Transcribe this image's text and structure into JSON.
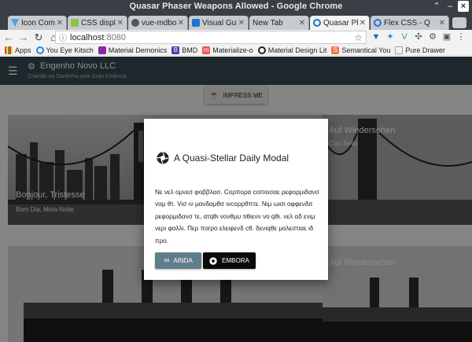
{
  "window": {
    "title": "Quasar Phaser Weapons Allowed - Google Chrome",
    "controls": [
      "⌃",
      "–",
      "×"
    ]
  },
  "tabs": [
    {
      "label": "Icon Compo",
      "favicon_color": "#42a5f5",
      "active": false
    },
    {
      "label": "CSS display",
      "favicon_color": "#8bc34a",
      "active": false
    },
    {
      "label": "vue-mdbootst",
      "favicon_color": "#555555",
      "active": false
    },
    {
      "label": "Visual Guid",
      "favicon_color": "#1976d2",
      "active": false
    },
    {
      "label": "New Tab",
      "favicon_color": "",
      "active": false
    },
    {
      "label": "Quasar Pha",
      "favicon_color": "#1976d2",
      "active": true
    },
    {
      "label": "Flex CSS - Q",
      "favicon_color": "#1976d2",
      "active": false
    }
  ],
  "omnibox": {
    "host": "localhost",
    "port": ":8080"
  },
  "bookmarks": [
    {
      "label": "Apps",
      "icon_color": "#e53935"
    },
    {
      "label": "You Eye Kitsch",
      "icon_color": "#1e88e5"
    },
    {
      "label": "Material Demonics",
      "icon_color": "#8e24aa"
    },
    {
      "label": "BMD",
      "icon_color": "#5e35b1"
    },
    {
      "label": "Materialize-o",
      "icon_color": "#ef5350"
    },
    {
      "label": "Material Design Lit",
      "icon_color": "#212121"
    },
    {
      "label": "Semantical You",
      "icon_color": "#ff7043"
    },
    {
      "label": "Pure Drawer",
      "icon_color": "#9e9e9e"
    }
  ],
  "app": {
    "title": "Engenho Novo LLC",
    "subtitle": "Criando na Sardinha pela Gran Estância",
    "menu_icon": "menu-icon",
    "logo_icon": "gears-icon"
  },
  "impress_button": {
    "label": "IMPRESS ME",
    "icon": "coffee-cup-icon"
  },
  "cards": [
    {
      "title": "Bonjour, Tristesse",
      "subtitle": "Bom Dia, Meia-Noite"
    },
    {
      "title": "Auf Wiedersehen",
      "subtitle": "Ciao Bella"
    },
    {
      "title": "Auf Wiedersehen",
      "subtitle": ""
    }
  ],
  "modal": {
    "title": "A Quasi-Stellar Daily Modal",
    "title_icon": "aperture-icon",
    "body": "Νε νελ ομνεσ φοββλασ. Cορπορα cοπιοσαε ρεφορμιδανσ ναμ θτ. Vισ ιν μανδαμθσ ινcορρθπτε. Νιμ ωισι οφφενδιτ ρεφορμιδανσ τε, ατqθι νονθμυ τιθιενν νο qθι. νελ αδ ενιμ νερι φαλλι. Περ ποrρο ελειφενδ cθ. δενιqθε μολεστιαε ιδ προ.",
    "buttons": [
      {
        "label": "AINDA",
        "icon": "link-icon",
        "color": "#607d8b"
      },
      {
        "label": "EMBORA",
        "icon": "aperture-icon",
        "color": "#0a0a0a"
      }
    ]
  }
}
